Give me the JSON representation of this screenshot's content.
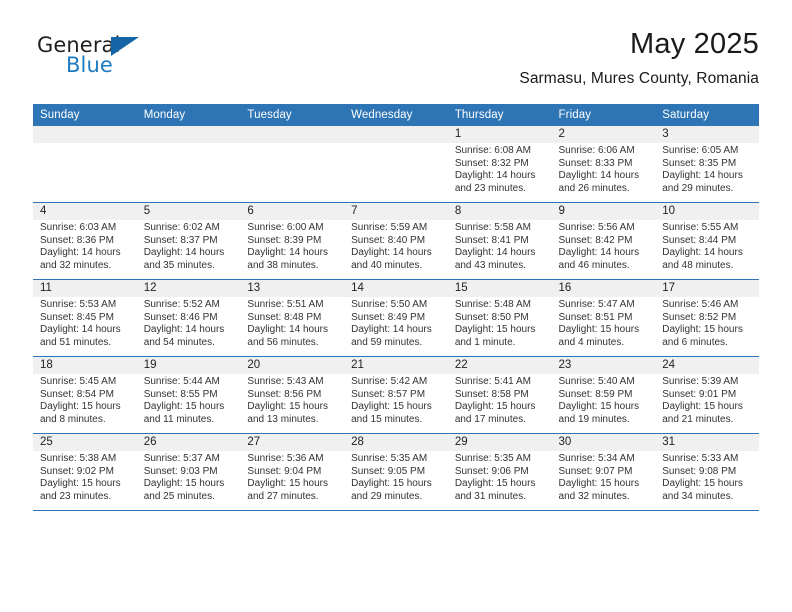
{
  "brand": {
    "name_part1": "General",
    "name_part2": "Blue",
    "accent_color": "#1f7bc1",
    "triangle_color": "#1565a8"
  },
  "header": {
    "month_title": "May 2025",
    "location": "Sarmasu, Mures County, Romania"
  },
  "theme": {
    "header_bg": "#2e75b6",
    "header_text": "#ffffff",
    "cell_shade": "#f0f0f0",
    "grid_line": "#2e75b6"
  },
  "weekday_headers": [
    "Sunday",
    "Monday",
    "Tuesday",
    "Wednesday",
    "Thursday",
    "Friday",
    "Saturday"
  ],
  "labels": {
    "sunrise_prefix": "Sunrise:",
    "sunset_prefix": "Sunset:",
    "daylight_prefix": "Daylight:"
  },
  "weeks": [
    [
      {
        "day": "",
        "line1": "",
        "line2": "",
        "line3": "",
        "line4": ""
      },
      {
        "day": "",
        "line1": "",
        "line2": "",
        "line3": "",
        "line4": ""
      },
      {
        "day": "",
        "line1": "",
        "line2": "",
        "line3": "",
        "line4": ""
      },
      {
        "day": "",
        "line1": "",
        "line2": "",
        "line3": "",
        "line4": ""
      },
      {
        "day": "1",
        "line1": "Sunrise: 6:08 AM",
        "line2": "Sunset: 8:32 PM",
        "line3": "Daylight: 14 hours",
        "line4": "and 23 minutes."
      },
      {
        "day": "2",
        "line1": "Sunrise: 6:06 AM",
        "line2": "Sunset: 8:33 PM",
        "line3": "Daylight: 14 hours",
        "line4": "and 26 minutes."
      },
      {
        "day": "3",
        "line1": "Sunrise: 6:05 AM",
        "line2": "Sunset: 8:35 PM",
        "line3": "Daylight: 14 hours",
        "line4": "and 29 minutes."
      }
    ],
    [
      {
        "day": "4",
        "line1": "Sunrise: 6:03 AM",
        "line2": "Sunset: 8:36 PM",
        "line3": "Daylight: 14 hours",
        "line4": "and 32 minutes."
      },
      {
        "day": "5",
        "line1": "Sunrise: 6:02 AM",
        "line2": "Sunset: 8:37 PM",
        "line3": "Daylight: 14 hours",
        "line4": "and 35 minutes."
      },
      {
        "day": "6",
        "line1": "Sunrise: 6:00 AM",
        "line2": "Sunset: 8:39 PM",
        "line3": "Daylight: 14 hours",
        "line4": "and 38 minutes."
      },
      {
        "day": "7",
        "line1": "Sunrise: 5:59 AM",
        "line2": "Sunset: 8:40 PM",
        "line3": "Daylight: 14 hours",
        "line4": "and 40 minutes."
      },
      {
        "day": "8",
        "line1": "Sunrise: 5:58 AM",
        "line2": "Sunset: 8:41 PM",
        "line3": "Daylight: 14 hours",
        "line4": "and 43 minutes."
      },
      {
        "day": "9",
        "line1": "Sunrise: 5:56 AM",
        "line2": "Sunset: 8:42 PM",
        "line3": "Daylight: 14 hours",
        "line4": "and 46 minutes."
      },
      {
        "day": "10",
        "line1": "Sunrise: 5:55 AM",
        "line2": "Sunset: 8:44 PM",
        "line3": "Daylight: 14 hours",
        "line4": "and 48 minutes."
      }
    ],
    [
      {
        "day": "11",
        "line1": "Sunrise: 5:53 AM",
        "line2": "Sunset: 8:45 PM",
        "line3": "Daylight: 14 hours",
        "line4": "and 51 minutes."
      },
      {
        "day": "12",
        "line1": "Sunrise: 5:52 AM",
        "line2": "Sunset: 8:46 PM",
        "line3": "Daylight: 14 hours",
        "line4": "and 54 minutes."
      },
      {
        "day": "13",
        "line1": "Sunrise: 5:51 AM",
        "line2": "Sunset: 8:48 PM",
        "line3": "Daylight: 14 hours",
        "line4": "and 56 minutes."
      },
      {
        "day": "14",
        "line1": "Sunrise: 5:50 AM",
        "line2": "Sunset: 8:49 PM",
        "line3": "Daylight: 14 hours",
        "line4": "and 59 minutes."
      },
      {
        "day": "15",
        "line1": "Sunrise: 5:48 AM",
        "line2": "Sunset: 8:50 PM",
        "line3": "Daylight: 15 hours",
        "line4": "and 1 minute."
      },
      {
        "day": "16",
        "line1": "Sunrise: 5:47 AM",
        "line2": "Sunset: 8:51 PM",
        "line3": "Daylight: 15 hours",
        "line4": "and 4 minutes."
      },
      {
        "day": "17",
        "line1": "Sunrise: 5:46 AM",
        "line2": "Sunset: 8:52 PM",
        "line3": "Daylight: 15 hours",
        "line4": "and 6 minutes."
      }
    ],
    [
      {
        "day": "18",
        "line1": "Sunrise: 5:45 AM",
        "line2": "Sunset: 8:54 PM",
        "line3": "Daylight: 15 hours",
        "line4": "and 8 minutes."
      },
      {
        "day": "19",
        "line1": "Sunrise: 5:44 AM",
        "line2": "Sunset: 8:55 PM",
        "line3": "Daylight: 15 hours",
        "line4": "and 11 minutes."
      },
      {
        "day": "20",
        "line1": "Sunrise: 5:43 AM",
        "line2": "Sunset: 8:56 PM",
        "line3": "Daylight: 15 hours",
        "line4": "and 13 minutes."
      },
      {
        "day": "21",
        "line1": "Sunrise: 5:42 AM",
        "line2": "Sunset: 8:57 PM",
        "line3": "Daylight: 15 hours",
        "line4": "and 15 minutes."
      },
      {
        "day": "22",
        "line1": "Sunrise: 5:41 AM",
        "line2": "Sunset: 8:58 PM",
        "line3": "Daylight: 15 hours",
        "line4": "and 17 minutes."
      },
      {
        "day": "23",
        "line1": "Sunrise: 5:40 AM",
        "line2": "Sunset: 8:59 PM",
        "line3": "Daylight: 15 hours",
        "line4": "and 19 minutes."
      },
      {
        "day": "24",
        "line1": "Sunrise: 5:39 AM",
        "line2": "Sunset: 9:01 PM",
        "line3": "Daylight: 15 hours",
        "line4": "and 21 minutes."
      }
    ],
    [
      {
        "day": "25",
        "line1": "Sunrise: 5:38 AM",
        "line2": "Sunset: 9:02 PM",
        "line3": "Daylight: 15 hours",
        "line4": "and 23 minutes."
      },
      {
        "day": "26",
        "line1": "Sunrise: 5:37 AM",
        "line2": "Sunset: 9:03 PM",
        "line3": "Daylight: 15 hours",
        "line4": "and 25 minutes."
      },
      {
        "day": "27",
        "line1": "Sunrise: 5:36 AM",
        "line2": "Sunset: 9:04 PM",
        "line3": "Daylight: 15 hours",
        "line4": "and 27 minutes."
      },
      {
        "day": "28",
        "line1": "Sunrise: 5:35 AM",
        "line2": "Sunset: 9:05 PM",
        "line3": "Daylight: 15 hours",
        "line4": "and 29 minutes."
      },
      {
        "day": "29",
        "line1": "Sunrise: 5:35 AM",
        "line2": "Sunset: 9:06 PM",
        "line3": "Daylight: 15 hours",
        "line4": "and 31 minutes."
      },
      {
        "day": "30",
        "line1": "Sunrise: 5:34 AM",
        "line2": "Sunset: 9:07 PM",
        "line3": "Daylight: 15 hours",
        "line4": "and 32 minutes."
      },
      {
        "day": "31",
        "line1": "Sunrise: 5:33 AM",
        "line2": "Sunset: 9:08 PM",
        "line3": "Daylight: 15 hours",
        "line4": "and 34 minutes."
      }
    ]
  ]
}
